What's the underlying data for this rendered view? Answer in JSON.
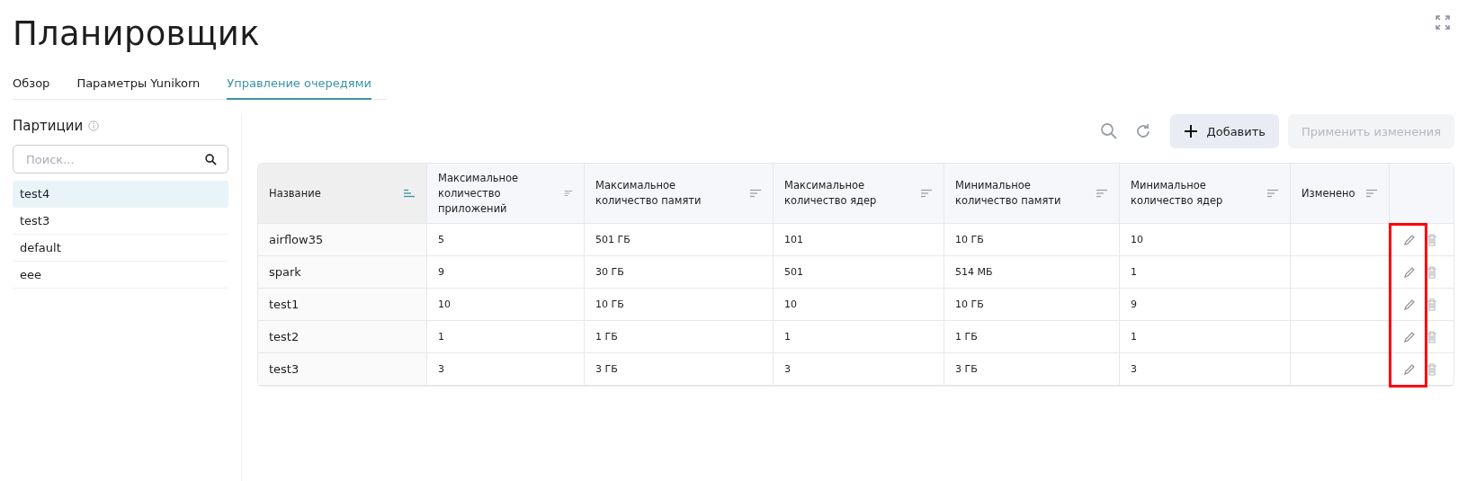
{
  "page": {
    "title": "Планировщик"
  },
  "tabs": [
    {
      "label": "Обзор",
      "selected": false
    },
    {
      "label": "Параметры Yunikorn",
      "selected": false
    },
    {
      "label": "Управление очередями",
      "selected": true
    }
  ],
  "sidebar": {
    "title": "Партиции",
    "search": {
      "placeholder": "Поиск..."
    },
    "items": [
      {
        "label": "test4",
        "selected": true
      },
      {
        "label": "test3",
        "selected": false
      },
      {
        "label": "default",
        "selected": false
      },
      {
        "label": "eee",
        "selected": false
      }
    ]
  },
  "toolbar": {
    "add_button": "Добавить",
    "apply_button": {
      "label": "Применить изменения",
      "disabled": true
    }
  },
  "table": {
    "columns": [
      {
        "label": "Название",
        "sorted": true
      },
      {
        "label": "Максимальное количество приложений",
        "sorted": false
      },
      {
        "label": "Максимальное количество памяти",
        "sorted": false
      },
      {
        "label": "Максимальное количество ядер",
        "sorted": false
      },
      {
        "label": "Минимальное количество памяти",
        "sorted": false
      },
      {
        "label": "Минимальное количество ядер",
        "sorted": false
      },
      {
        "label": "Изменено",
        "sorted": false
      }
    ],
    "actions_highlighted": true,
    "rows": [
      [
        "airflow35",
        "5",
        "501 ГБ",
        "101",
        "10 ГБ",
        "10",
        ""
      ],
      [
        "spark",
        "9",
        "30 ГБ",
        "501",
        "514 МБ",
        "1",
        ""
      ],
      [
        "test1",
        "10",
        "10 ГБ",
        "10",
        "10 ГБ",
        "9",
        ""
      ],
      [
        "test2",
        "1",
        "1 ГБ",
        "1",
        "1 ГБ",
        "1",
        ""
      ],
      [
        "test3",
        "3",
        "3 ГБ",
        "3",
        "3 ГБ",
        "3",
        ""
      ]
    ]
  }
}
